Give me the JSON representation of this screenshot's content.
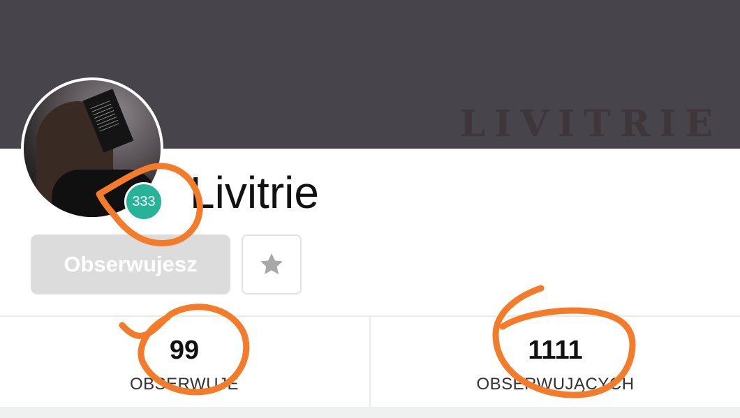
{
  "banner": {
    "brand_text": "LIVITRIE"
  },
  "profile": {
    "username": "Livitrie",
    "level": "333"
  },
  "actions": {
    "follow_label": "Obserwujesz",
    "favorite_icon": "star-icon"
  },
  "stats": [
    {
      "value": "99",
      "label": "OBSERWUJE"
    },
    {
      "value": "1111",
      "label": "OBSERWUJĄCYCH"
    }
  ],
  "colors": {
    "banner": "#47444b",
    "level_badge": "#27b39a",
    "follow_button": "#dcdcdc",
    "annotation": "#f47b2a"
  }
}
